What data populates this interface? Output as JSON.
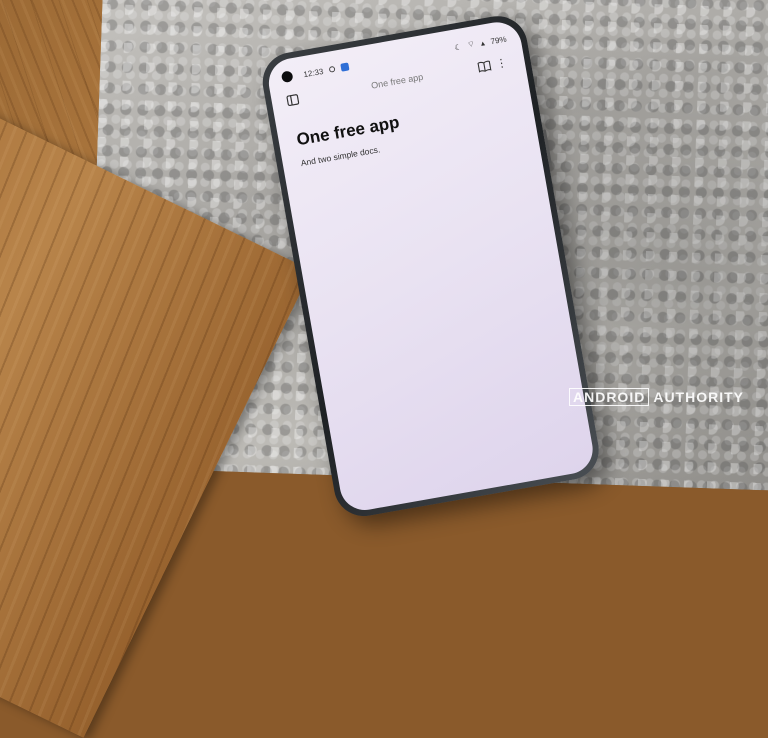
{
  "status_bar": {
    "time": "12:33",
    "battery": "79%"
  },
  "app_bar": {
    "title": "One free app"
  },
  "content": {
    "heading": "One free app",
    "subheading": "And two simple docs."
  },
  "watermark": {
    "word1": "ANDROID",
    "word2": "AUTHORITY"
  },
  "colors": {
    "screen_bg": "#ece5f3",
    "accent_blue": "#2f6fd6"
  }
}
